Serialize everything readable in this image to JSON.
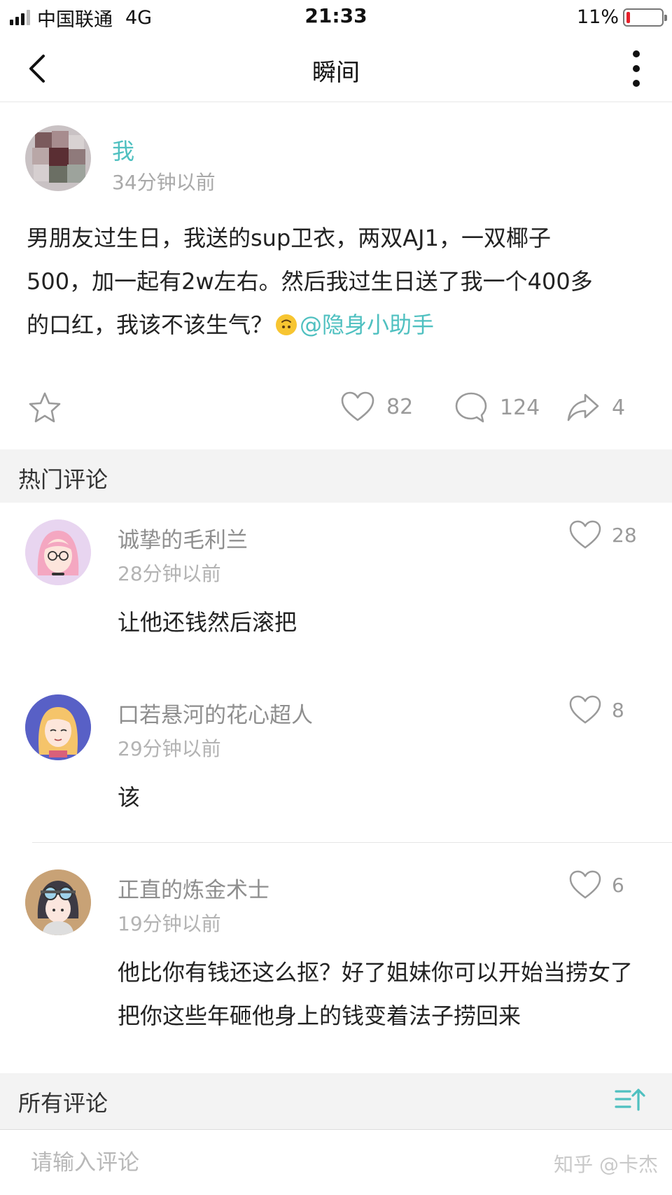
{
  "status_bar": {
    "carrier": "中国联通",
    "network": "4G",
    "time": "21:33",
    "battery_percent": "11%",
    "battery_level": 0.11,
    "battery_color": "#e6202a"
  },
  "nav": {
    "title": "瞬间",
    "back_icon": "chevron-left-icon",
    "more_icon": "more-vertical-icon"
  },
  "post": {
    "author": "我",
    "time": "34分钟以前",
    "text_line1": "男朋友过生日，我送的sup卫衣，两双AJ1，一双椰子",
    "text_line2": "500，加一起有2w左右。然后我过生日送了我一个400多",
    "text_line3": "的口红，我该不该生气？",
    "mention": "@隐身小助手",
    "likes": "82",
    "comments": "124",
    "shares": "4"
  },
  "hot_section": {
    "label": "热门评论"
  },
  "comments": [
    {
      "name": "诚挚的毛利兰",
      "time": "28分钟以前",
      "likes": "28",
      "text": "让他还钱然后滚把"
    },
    {
      "name": "口若悬河的花心超人",
      "time": "29分钟以前",
      "likes": "8",
      "text": "该"
    },
    {
      "name": "正直的炼金术士",
      "time": "19分钟以前",
      "likes": "6",
      "text": "他比你有钱还这么抠？好了姐妹你可以开始当捞女了把你这些年砸他身上的钱变着法子捞回来"
    }
  ],
  "all_section": {
    "label": "所有评论",
    "sort_icon": "sort-ascending-icon"
  },
  "input": {
    "placeholder": "请输入评论"
  },
  "watermark": "知乎 @卡杰",
  "colors": {
    "accent": "#4fc0c0",
    "section_bg": "#f3f3f3",
    "muted": "#9a9a9a"
  }
}
